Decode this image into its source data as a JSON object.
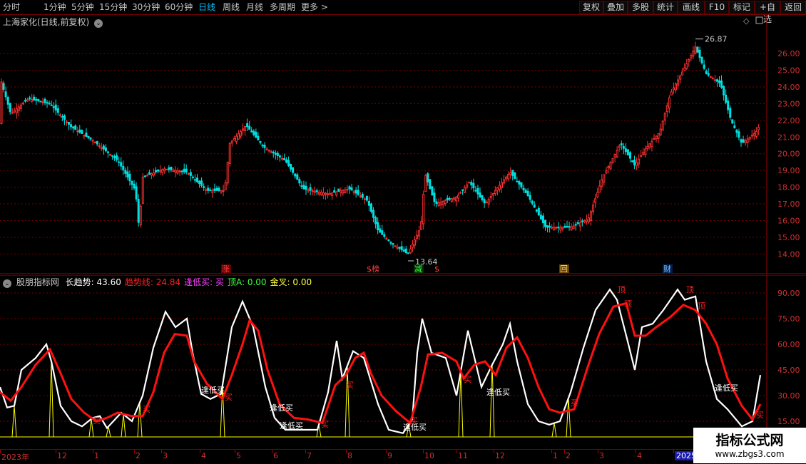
{
  "toolbar": {
    "periods": [
      "分时",
      "1分钟",
      "5分钟",
      "15分钟",
      "30分钟",
      "60分钟",
      "日线",
      "周线",
      "月线",
      "多周期",
      "更多 >"
    ],
    "active_period": "日线",
    "right_buttons": [
      "复权",
      "叠加",
      "多股",
      "统计",
      "画线",
      "F10",
      "标记",
      "+自选",
      "返回"
    ]
  },
  "main_chart": {
    "title": "上海家化(日线,前复权)",
    "high_label": "26.87",
    "low_label": "13.64",
    "y_ticks": [
      "26.00",
      "25.00",
      "24.00",
      "23.00",
      "22.00",
      "21.00",
      "20.00",
      "19.00",
      "18.00",
      "17.00",
      "16.00",
      "15.00",
      "14.00"
    ],
    "event_markers": [
      {
        "text": "涨",
        "color": "#ff4040",
        "bg": "#600000"
      },
      {
        "text": "$榜",
        "color": "#ff4040",
        "bg": "#000"
      },
      {
        "text": "减",
        "color": "#40ff40",
        "bg": "#003000"
      },
      {
        "text": "$",
        "color": "#ff4040",
        "bg": "#000"
      },
      {
        "text": "回",
        "color": "#ffd080",
        "bg": "#604000"
      },
      {
        "text": "财",
        "color": "#80c0ff",
        "bg": "#002050"
      }
    ]
  },
  "indicator": {
    "name": "股朋指标网",
    "values": [
      {
        "label": "长趋势: ",
        "value": "43.60",
        "color": "#ffffff"
      },
      {
        "label": "趋势线: ",
        "value": "24.84",
        "color": "#ff2020"
      },
      {
        "label": "逢低买: ",
        "value": "买",
        "color": "#ff40ff"
      },
      {
        "label": "顶A: ",
        "value": "0.00",
        "color": "#40ff40"
      },
      {
        "label": "金叉: ",
        "value": "0.00",
        "color": "#ffff40"
      }
    ],
    "y_ticks": [
      "90.00",
      "75.00",
      "60.00",
      "45.00",
      "30.00",
      "15.00"
    ],
    "annotation_buy_low": "逢低买",
    "annotation_top": "顶",
    "annotation_buy": "买"
  },
  "x_axis": {
    "labels": [
      "2023年",
      "12",
      "1",
      "2",
      "3",
      "4",
      "5",
      "6",
      "7",
      "8",
      "9",
      "10",
      "11",
      "12",
      "1",
      "2",
      "3",
      "4",
      "2025"
    ]
  },
  "watermark": {
    "brand": "指标公式网",
    "url": "www.zbgs3.com"
  },
  "colors": {
    "up": "#ff3030",
    "down": "#00e0e0",
    "white": "#ffffff",
    "red": "#ff1010",
    "yellow": "#ffff00",
    "grid": "#7a0000"
  }
}
